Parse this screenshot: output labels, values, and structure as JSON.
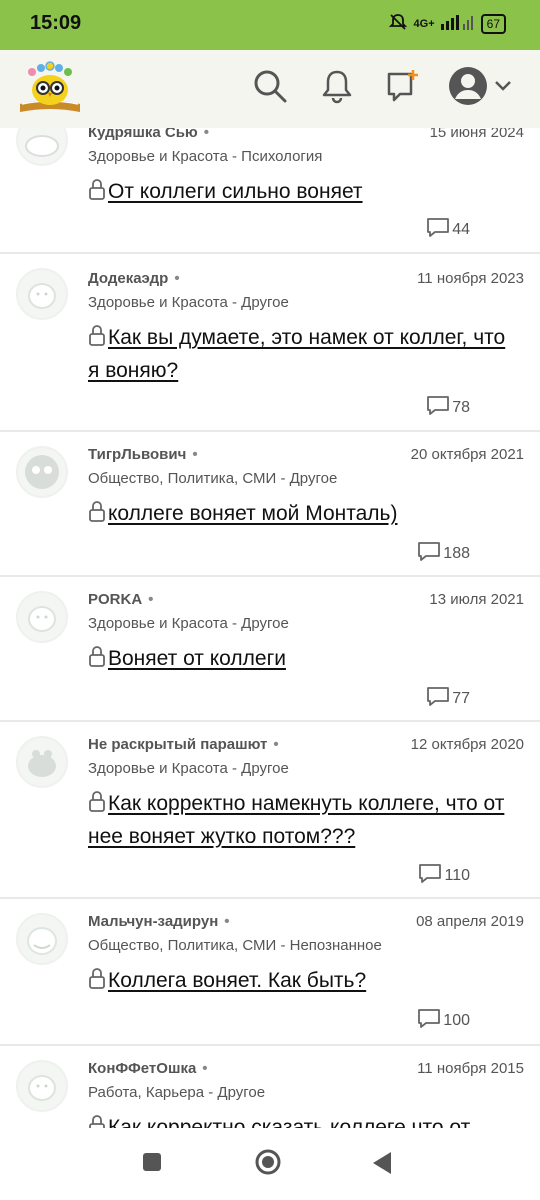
{
  "status": {
    "time": "15:09",
    "network": "4G+",
    "battery": "67"
  },
  "header": {
    "icons": {
      "logo": "owl-books-logo",
      "search": "search-icon",
      "bell": "bell-icon",
      "ask": "add-question-icon",
      "profile": "user-avatar-icon",
      "dropdown": "chevron-down-icon"
    }
  },
  "posts": [
    {
      "author": "Кудряшка Сью",
      "dot": "•",
      "date": "15 июня 2024",
      "category": "Здоровье и Красота - Психология",
      "title": "От коллеги сильно воняет",
      "comments": "44"
    },
    {
      "author": "Додекаэдр",
      "dot": "•",
      "date": "11 ноября 2023",
      "category": "Здоровье и Красота - Другое",
      "title": "Как вы думаете, это намек от коллег, что я воняю?",
      "comments": "78"
    },
    {
      "author": "ТигрЛьвович",
      "dot": "•",
      "date": "20 октября 2021",
      "category": "Общество, Политика, СМИ - Другое",
      "title": "коллеге воняет мой Монталь)",
      "comments": "188"
    },
    {
      "author": "PORKA",
      "dot": "•",
      "date": "13 июля 2021",
      "category": "Здоровье и Красота - Другое",
      "title": "Воняет от коллеги",
      "comments": "77"
    },
    {
      "author": "Не раскрытый парашют",
      "dot": "•",
      "date": "12 октября 2020",
      "category": "Здоровье и Красота - Другое",
      "title": "Как корректно намекнуть коллеге, что от нее воняет жутко потом???",
      "comments": "110"
    },
    {
      "author": "Мальчун-задирун",
      "dot": "•",
      "date": "08 апреля 2019",
      "category": "Общество, Политика, СМИ - Непознанное",
      "title": "Коллега воняет. Как быть?",
      "comments": "100"
    },
    {
      "author": "КонФФетОшка",
      "dot": "•",
      "date": "11 ноября 2015",
      "category": "Работа, Карьера - Другое",
      "title": "Как корректно сказать коллеге что от",
      "comments": ""
    }
  ],
  "navbar": {
    "icons": {
      "recents": "square-recents-icon",
      "home": "circle-home-icon",
      "back": "triangle-back-icon"
    }
  }
}
